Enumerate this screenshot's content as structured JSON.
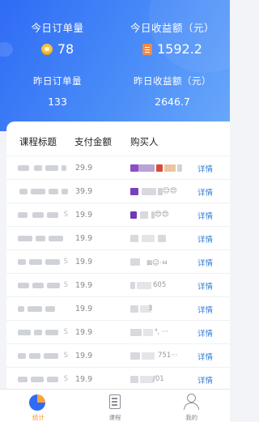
{
  "stats": {
    "today_orders": {
      "label": "今日订单量",
      "value": "78",
      "icon": "coin-bag-icon"
    },
    "today_income": {
      "label": "今日收益额（元）",
      "value": "1592.2",
      "icon": "document-icon"
    },
    "yesterday_orders": {
      "label": "昨日订单量",
      "value": "133"
    },
    "yesterday_income": {
      "label": "昨日收益额（元）",
      "value": "2646.7"
    }
  },
  "table": {
    "headers": [
      "课程标题",
      "支付金额",
      "购买人"
    ],
    "rows": [
      {
        "title_tail": "",
        "amount": "29.9",
        "buyer_text": "",
        "detail": "详情"
      },
      {
        "title_tail": "",
        "amount": "39.9",
        "buyer_text": "😊😍",
        "detail": "详情"
      },
      {
        "title_tail": "S",
        "amount": "19.9",
        "buyer_text": "😍😍",
        "detail": "详情"
      },
      {
        "title_tail": "",
        "amount": "19.9",
        "buyer_text": "",
        "detail": "详情"
      },
      {
        "title_tail": "S",
        "amount": "19.9",
        "buyer_text": "⊠☺·ㅂ",
        "detail": "详情"
      },
      {
        "title_tail": "S",
        "amount": "19.9",
        "buyer_text": "605",
        "detail": "详情"
      },
      {
        "title_tail": "",
        "amount": "19.9",
        "buyer_text": "3",
        "detail": "详情"
      },
      {
        "title_tail": "S",
        "amount": "19.9",
        "buyer_text": "⁴, ···",
        "detail": "详情"
      },
      {
        "title_tail": "S",
        "amount": "19.9",
        "buyer_text": "751···",
        "detail": "详情"
      },
      {
        "title_tail": "S",
        "amount": "19.9",
        "buyer_text": "/01",
        "detail": "详情"
      }
    ]
  },
  "tabbar": {
    "tabs": [
      {
        "label": "统计",
        "icon": "pie-chart-icon",
        "active": true
      },
      {
        "label": "课程",
        "icon": "book-icon",
        "active": false
      },
      {
        "label": "我的",
        "icon": "user-icon",
        "active": false
      }
    ]
  },
  "colors": {
    "primary": "#2f6bf5",
    "accent": "#f29a2e",
    "link": "#2f7ad6"
  }
}
